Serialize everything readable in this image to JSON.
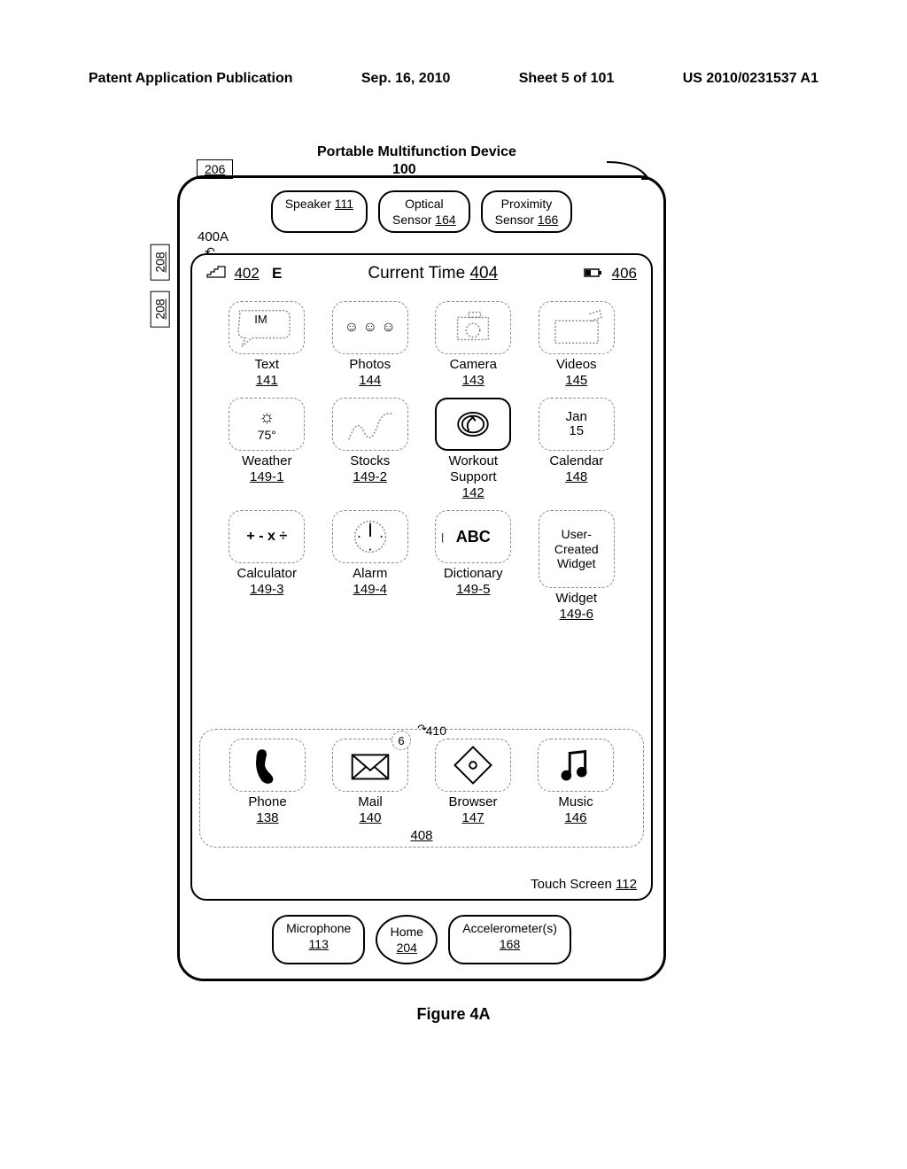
{
  "header": {
    "left": "Patent Application Publication",
    "date": "Sep. 16, 2010",
    "sheet": "Sheet 5 of 101",
    "pubno": "US 2010/0231537 A1"
  },
  "device": {
    "title": "Portable Multifunction Device",
    "ref": "100",
    "ref_206": "206",
    "ref_208": "208",
    "ref_400A": "400A"
  },
  "sensors": {
    "speaker": {
      "label": "Speaker",
      "ref": "111"
    },
    "optical": {
      "label1": "Optical",
      "label2": "Sensor",
      "ref": "164"
    },
    "proximity": {
      "label1": "Proximity",
      "label2": "Sensor",
      "ref": "166"
    }
  },
  "status": {
    "signal_ref": "402",
    "e_label": "E",
    "time_label": "Current Time",
    "time_ref": "404",
    "battery_ref": "406"
  },
  "apps": {
    "row1": [
      {
        "icon_text": "IM",
        "label": "Text",
        "ref": "141"
      },
      {
        "icon_text": "",
        "label": "Photos",
        "ref": "144"
      },
      {
        "icon_text": "",
        "label": "Camera",
        "ref": "143"
      },
      {
        "icon_text": "",
        "label": "Videos",
        "ref": "145"
      }
    ],
    "row2": [
      {
        "icon_text": "75°",
        "label": "Weather",
        "ref": "149-1"
      },
      {
        "icon_text": "",
        "label": "Stocks",
        "ref": "149-2"
      },
      {
        "icon_text": "",
        "label": "Workout Support",
        "ref": "142"
      },
      {
        "icon_text": "Jan\n15",
        "label": "Calendar",
        "ref": "148"
      }
    ],
    "row3": [
      {
        "icon_text": "+ - x ÷",
        "label": "Calculator",
        "ref": "149-3"
      },
      {
        "icon_text": "",
        "label": "Alarm",
        "ref": "149-4"
      },
      {
        "icon_text": "ABC",
        "label": "Dictionary",
        "ref": "149-5"
      },
      {
        "icon_text": "User-Created Widget",
        "label": "Widget",
        "ref": "149-6"
      }
    ]
  },
  "dock": {
    "ref": "408",
    "badge": {
      "count": "6",
      "ref": "410"
    },
    "apps": [
      {
        "label": "Phone",
        "ref": "138"
      },
      {
        "label": "Mail",
        "ref": "140"
      },
      {
        "label": "Browser",
        "ref": "147"
      },
      {
        "label": "Music",
        "ref": "146"
      }
    ]
  },
  "touch_screen": {
    "label": "Touch Screen",
    "ref": "112"
  },
  "bottom": {
    "microphone": {
      "label": "Microphone",
      "ref": "113"
    },
    "home": {
      "label": "Home",
      "ref": "204"
    },
    "accel": {
      "label": "Accelerometer(s)",
      "ref": "168"
    }
  },
  "figure": "Figure 4A"
}
